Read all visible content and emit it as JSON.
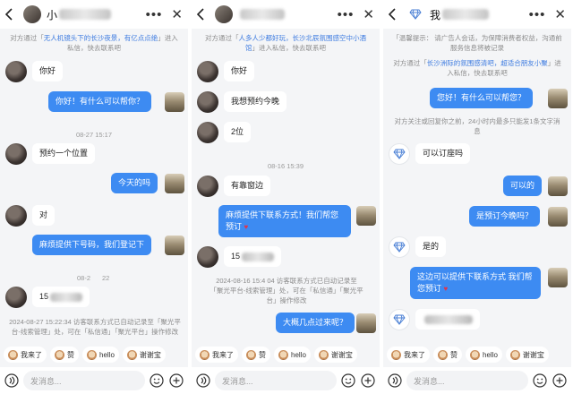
{
  "colors": {
    "accent": "#3d8bf2",
    "link": "#3d7be0",
    "system_text": "#8c8c8c",
    "background": "#f4f5f7"
  },
  "panels": [
    {
      "header": {
        "title": "小"
      },
      "system_notice": {
        "prefix": "对方通过「",
        "link": "无人机镜头下的长沙夜景，有亿点点绝",
        "suffix": "」进入私信，快去联系吧"
      },
      "messages": [
        {
          "from": "user",
          "text": "你好"
        },
        {
          "from": "shop",
          "text": "你好！有什么可以帮你？"
        },
        {
          "kind": "time",
          "text": "08-27 15:17"
        },
        {
          "from": "user",
          "text": "预约一个位置"
        },
        {
          "from": "shop",
          "text": "今天的吗"
        },
        {
          "from": "user",
          "text": "对"
        },
        {
          "from": "shop",
          "text": "麻烦提供下号码，我们登记下"
        },
        {
          "kind": "time",
          "text": "08-2"
        },
        {
          "kind": "time",
          "text": "22"
        },
        {
          "from": "user",
          "text": "15"
        }
      ],
      "record_notice": "2024-08-27 15:22:34 访客联系方式已自动记录至「聚光平台-线索管理」处，可在「私信通」「聚光平台」操作修改",
      "quick_replies": [
        "我来了",
        "赞",
        "hello",
        "谢谢宝"
      ],
      "input_placeholder": "发消息..."
    },
    {
      "header": {
        "title": ""
      },
      "system_notice": {
        "prefix": "对方通过「",
        "link": "人多人少都好玩，长沙北辰氛围感空中小酒馆",
        "suffix": "」进入私信，快去联系吧"
      },
      "messages": [
        {
          "from": "user",
          "text": "你好"
        },
        {
          "from": "user",
          "text": "我想预约今晚"
        },
        {
          "from": "user",
          "text": "2位"
        },
        {
          "kind": "time",
          "text": "08-16 15:39"
        },
        {
          "from": "user",
          "text": "有靠窗边"
        },
        {
          "from": "shop",
          "text": "麻烦提供下联系方式！我们帮您预订"
        },
        {
          "from": "user",
          "text": "15"
        }
      ],
      "record_notice": "2024-08-16 15:4   04 访客联系方式已自动记录至「聚光平台-线索管理」处，可在「私信通」「聚光平台」操作修改",
      "tail_message": {
        "from": "shop",
        "text": "大概几点过来呢？"
      },
      "quick_replies": [
        "我来了",
        "赞",
        "hello",
        "谢谢宝"
      ],
      "input_placeholder": "发消息..."
    },
    {
      "header": {
        "title": "我"
      },
      "warm_tip": "「温馨提示：  请广告人会话，为保障消费者权益，沟通前服务信息将被记录",
      "system_notice": {
        "prefix": "对方通过「",
        "link": "长沙洲际的氛围感清吧，超适合朋友小聚",
        "suffix": "」进入私信，快去联系吧"
      },
      "messages": [
        {
          "from": "shop",
          "text": "您好！有什么可以帮您？"
        },
        {
          "kind": "notice",
          "text": "对方关注或回复你之前，24小时内最多只能发1条文字消息"
        },
        {
          "from": "gem",
          "text": "可以订座吗"
        },
        {
          "from": "shop",
          "text": "可以的"
        },
        {
          "from": "shop",
          "text": "是预订今晚吗？"
        },
        {
          "from": "gem",
          "text": "是的"
        },
        {
          "from": "shop",
          "text": "这边可以提供下联系方式 我们帮您预订"
        },
        {
          "from": "gem",
          "text": ""
        }
      ],
      "quick_replies": [
        "我来了",
        "赞",
        "hello",
        "谢谢宝"
      ],
      "input_placeholder": "发消息..."
    }
  ]
}
